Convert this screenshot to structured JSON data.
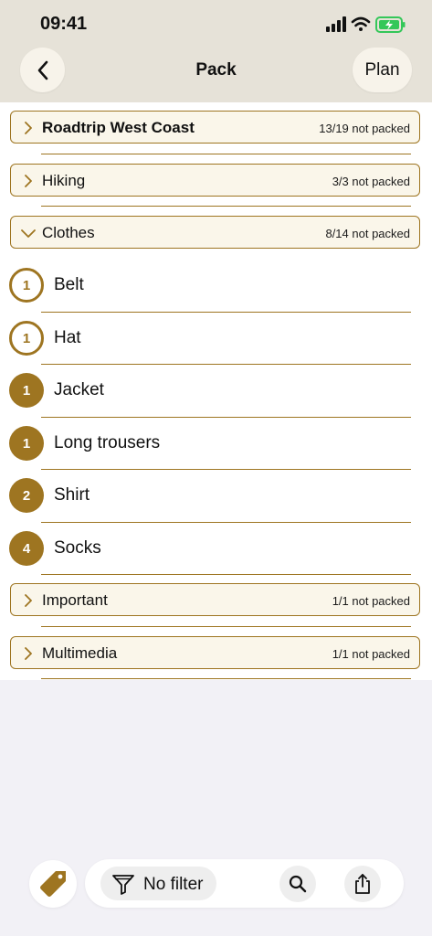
{
  "status_bar": {
    "time": "09:41"
  },
  "nav": {
    "title": "Pack",
    "plan_label": "Plan"
  },
  "categories": [
    {
      "name": "Roadtrip West Coast",
      "status": "13/19 not packed",
      "expanded": false
    },
    {
      "name": "Hiking",
      "status": "3/3 not packed",
      "expanded": false
    },
    {
      "name": "Clothes",
      "status": "8/14 not packed",
      "expanded": true
    },
    {
      "name": "Important",
      "status": "1/1 not packed",
      "expanded": false
    },
    {
      "name": "Multimedia",
      "status": "1/1 not packed",
      "expanded": false
    }
  ],
  "items": [
    {
      "name": "Belt",
      "count": "1",
      "packed": false
    },
    {
      "name": "Hat",
      "count": "1",
      "packed": false
    },
    {
      "name": "Jacket",
      "count": "1",
      "packed": true
    },
    {
      "name": "Long trousers",
      "count": "1",
      "packed": true
    },
    {
      "name": "Shirt",
      "count": "2",
      "packed": true
    },
    {
      "name": "Socks",
      "count": "4",
      "packed": true
    }
  ],
  "toolbar": {
    "filter_label": "No filter"
  },
  "colors": {
    "accent": "#9e7521",
    "header_bg": "#e6e2d8",
    "category_bg": "#faf6ea",
    "battery": "#34c759"
  },
  "icons": [
    "back-chevron-icon",
    "signal-icon",
    "wifi-icon",
    "battery-icon",
    "chevron-right-icon",
    "chevron-down-icon",
    "tag-icon",
    "filter-icon",
    "search-icon",
    "share-icon"
  ]
}
